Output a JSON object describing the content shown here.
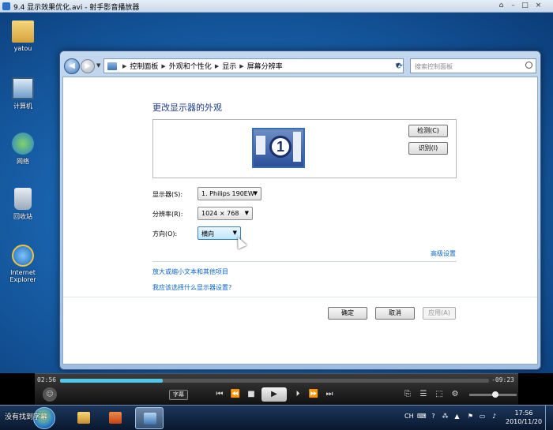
{
  "player": {
    "title": "9.4 显示效果优化.avi - 射手影音播放器",
    "time_elapsed": "02:56",
    "time_remaining": "-09:23",
    "progress": 0.24,
    "subtitle_label": "字幕",
    "volume": 0.55
  },
  "desktop": {
    "icons": [
      {
        "label": "yatou",
        "icon": "folder-icon"
      },
      {
        "label": "计算机",
        "icon": "computer-icon"
      },
      {
        "label": "网络",
        "icon": "network-icon"
      },
      {
        "label": "回收站",
        "icon": "recycle-bin-icon"
      },
      {
        "label": "Internet Explorer",
        "icon": "ie-icon"
      }
    ]
  },
  "explorer": {
    "breadcrumb": [
      "控制面板",
      "外观和个性化",
      "显示",
      "屏幕分辨率"
    ],
    "search_placeholder": "搜索控制面板",
    "page_title": "更改显示器的外观",
    "monitor_number": "1",
    "detect_button": "检测(C)",
    "identify_button": "识别(I)",
    "display_label": "显示器(S):",
    "display_value": "1. Philips 190EW",
    "resolution_label": "分辨率(R):",
    "resolution_value": "1024 × 768",
    "orientation_label": "方向(O):",
    "orientation_value": "横向",
    "advanced_link": "高级设置",
    "link_text_size": "放大或缩小文本和其他项目",
    "link_which_settings": "我应该选择什么显示器设置?",
    "ok_button": "确定",
    "cancel_button": "取消",
    "apply_button": "应用(A)"
  },
  "taskbar": {
    "tooltip": "没有找到字幕",
    "tray_lang": "CH",
    "clock_time": "17:56",
    "clock_date": "2010/11/20"
  }
}
